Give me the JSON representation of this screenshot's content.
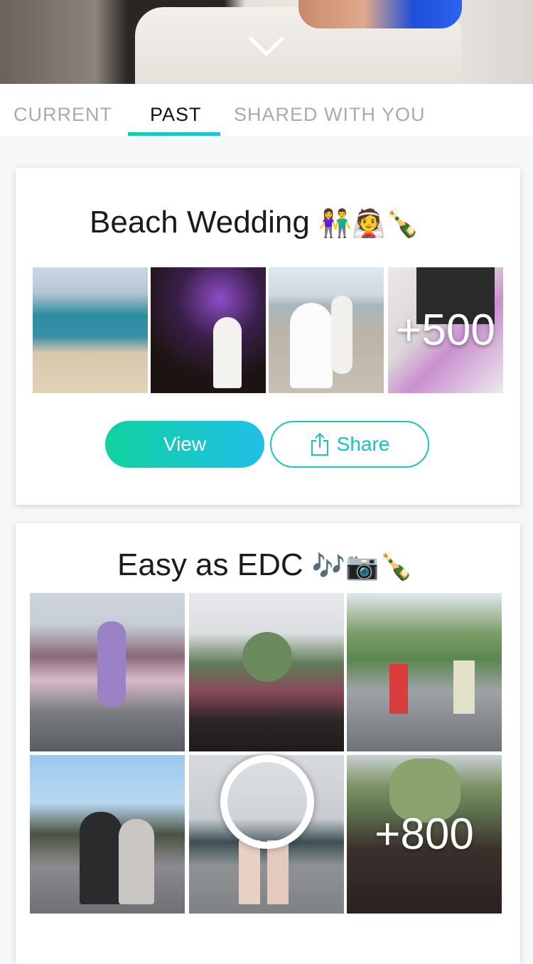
{
  "tabs": [
    {
      "label": "CURRENT"
    },
    {
      "label": "PAST",
      "active": true
    },
    {
      "label": "SHARED WITH YOU"
    }
  ],
  "albums": [
    {
      "title": "Beach Wedding",
      "emojis": "👫👰🍾",
      "more_count": "+500",
      "view_label": "View",
      "share_label": "Share"
    },
    {
      "title": "Easy as EDC",
      "emojis": "🎶📷🍾",
      "more_count": "+800"
    }
  ],
  "colors": {
    "accent_start": "#13d1a3",
    "accent_end": "#1bbfe6",
    "share_border": "#19c7b8"
  },
  "icons": {
    "collapse": "chevron-down-icon",
    "share": "share-icon"
  }
}
